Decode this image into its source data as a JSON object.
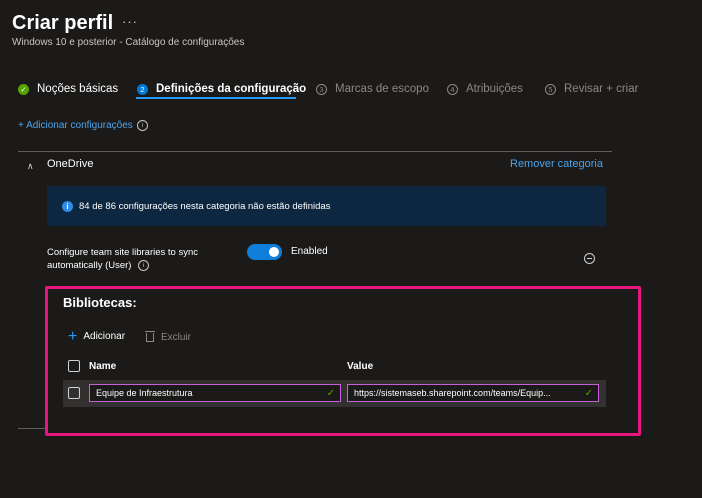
{
  "header": {
    "title": "Criar perfil",
    "more_glyph": "···",
    "subtitle": "Windows 10 e posterior - Catálogo de configurações"
  },
  "steps": [
    {
      "label": "Noções básicas",
      "marker": "✓",
      "state": "done"
    },
    {
      "label": "Definições da configuração",
      "marker": "2",
      "state": "active"
    },
    {
      "label": "Marcas de escopo",
      "marker": "3",
      "state": "todo"
    },
    {
      "label": "Atribuições",
      "marker": "4",
      "state": "todo"
    },
    {
      "label": "Revisar + criar",
      "marker": "5",
      "state": "todo"
    }
  ],
  "add_config": {
    "label": "+ Adicionar configurações",
    "info_glyph": "i"
  },
  "category": {
    "chevron": "∧",
    "name": "OneDrive",
    "remove_label": "Remover categoria",
    "banner_icon": "i",
    "banner_text": "84 de 86 configurações nesta categoria não estão definidas"
  },
  "setting": {
    "label": "Configure team site libraries to sync automatically (User)",
    "info_glyph": "i",
    "toggle_on": true,
    "toggle_text": "Enabled"
  },
  "libraries": {
    "title": "Bibliotecas:",
    "add_label": "Adicionar",
    "add_glyph": "+",
    "delete_label": "Excluir",
    "col_name": "Name",
    "col_value": "Value",
    "rows": [
      {
        "name": "Equipe de Infraestrutura",
        "value": "https://sistemaseb.sharepoint.com/teams/Equip..."
      }
    ],
    "check_glyph": "✓"
  },
  "colors": {
    "accent": "#0078d4",
    "link": "#4fa3e8",
    "success": "#57a300",
    "highlight": "#e8157f",
    "banner_bg": "#0d2741"
  }
}
